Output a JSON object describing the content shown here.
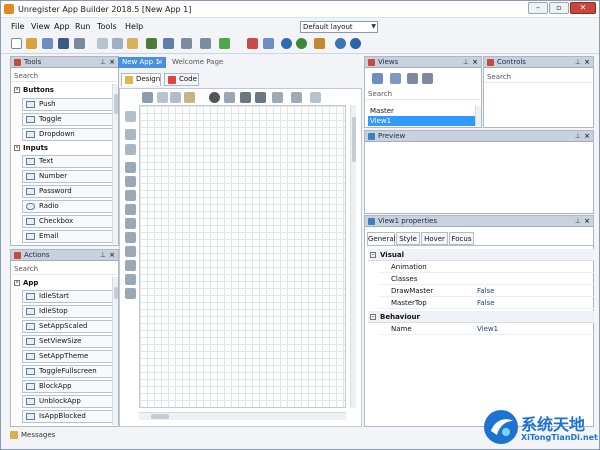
{
  "window": {
    "title": "Unregister App Builder 2018.5 [New App 1]",
    "minimize": "–",
    "restore": "▫",
    "close": "✕"
  },
  "menu": [
    "File",
    "View",
    "App",
    "Run",
    "Tools",
    "Help"
  ],
  "toolbar": {
    "layout_select": "Default layout"
  },
  "tools": {
    "title": "Tools",
    "search": "Search",
    "categories": [
      {
        "name": "Buttons",
        "items": [
          "Push",
          "Toggle",
          "Dropdown"
        ]
      },
      {
        "name": "Inputs",
        "items": [
          "Text",
          "Number",
          "Password",
          "Radio",
          "Checkbox",
          "Email"
        ]
      }
    ]
  },
  "actions": {
    "title": "Actions",
    "search": "Search",
    "category": "App",
    "items": [
      "IdleStart",
      "IdleStop",
      "SetAppScaled",
      "SetViewSize",
      "SetAppTheme",
      "ToggleFullscreen",
      "BlockApp",
      "UnblockApp",
      "IsAppBlocked"
    ]
  },
  "messages": "Messages",
  "documents": {
    "tabs": [
      "New App 1",
      "Welcome Page"
    ],
    "subtabs": [
      "Design",
      "Code"
    ]
  },
  "views": {
    "title": "Views",
    "search": "Search",
    "items": [
      "Master",
      "View1"
    ],
    "selected": "View1"
  },
  "controls": {
    "title": "Controls",
    "search": "Search"
  },
  "preview": {
    "title": "Preview"
  },
  "properties": {
    "title": "View1 properties",
    "tabs": [
      "General",
      "Style",
      "Hover",
      "Focus"
    ],
    "sections": [
      {
        "name": "Visual",
        "rows": [
          {
            "key": "Animation",
            "value": ""
          },
          {
            "key": "Classes",
            "value": ""
          },
          {
            "key": "DrawMaster",
            "value": "False"
          },
          {
            "key": "MasterTop",
            "value": "False"
          }
        ]
      },
      {
        "name": "Behaviour",
        "rows": [
          {
            "key": "Name",
            "value": "View1"
          }
        ]
      }
    ]
  },
  "watermark": {
    "cn": "系统天地",
    "url": "XiTongTianDi.net"
  },
  "colors": {
    "panel_header": "#c7d2de",
    "selection": "#3399ff",
    "close_button": "#c8473c",
    "link_value": "#1b3f8f"
  }
}
